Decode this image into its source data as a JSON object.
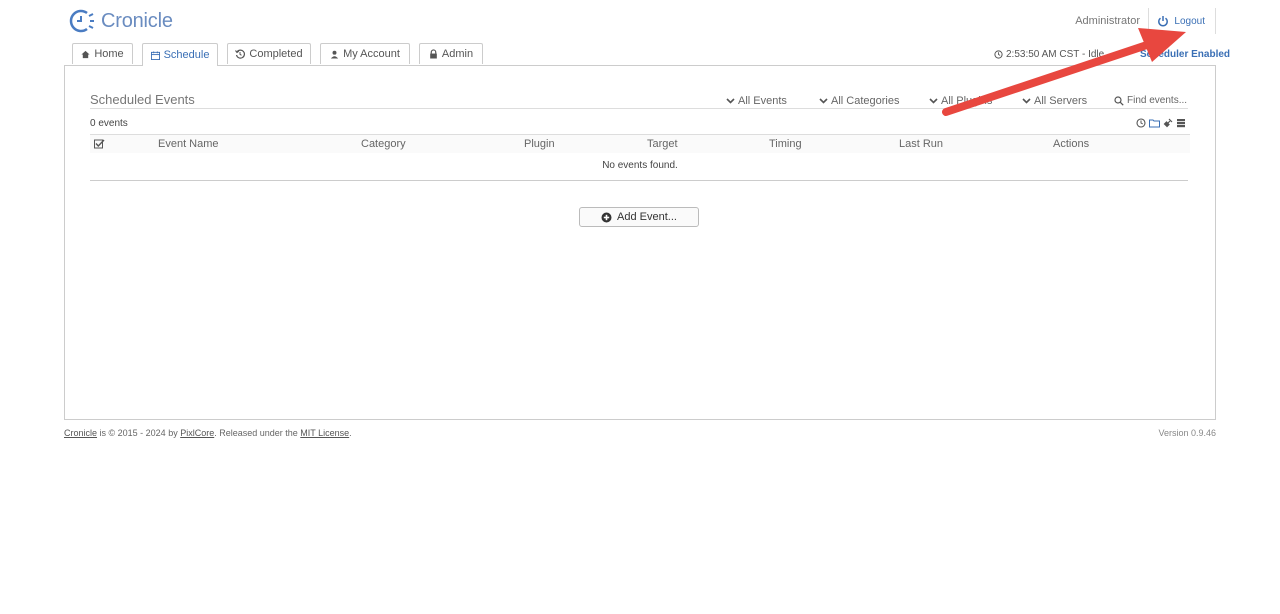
{
  "app": {
    "name": "Cronicle"
  },
  "header": {
    "user": "Administrator",
    "logout_label": "Logout"
  },
  "tabs": [
    {
      "label": "Home",
      "icon": "home-icon"
    },
    {
      "label": "Schedule",
      "icon": "calendar-icon",
      "active": true
    },
    {
      "label": "Completed",
      "icon": "history-icon"
    },
    {
      "label": "My Account",
      "icon": "user-icon"
    },
    {
      "label": "Admin",
      "icon": "lock-icon"
    }
  ],
  "status": {
    "time": "2:53:50 AM CST - Idle",
    "scheduler": "Scheduler Enabled"
  },
  "schedule": {
    "title": "Scheduled Events",
    "filters": [
      "All Events",
      "All Categories",
      "All Plugins",
      "All Servers"
    ],
    "search_placeholder": "Find events...",
    "count": "0 events",
    "columns": [
      "Event Name",
      "Category",
      "Plugin",
      "Target",
      "Timing",
      "Last Run",
      "Actions"
    ],
    "empty": "No events found.",
    "add_label": "Add Event..."
  },
  "footer": {
    "product": "Cronicle",
    "copyright_mid": " is © 2015 - 2024 by ",
    "company": "PixlCore",
    "released": ". Released under the ",
    "license": "MIT License",
    "period": ".",
    "version": "Version 0.9.46"
  },
  "colors": {
    "accent": "#3a6fb5",
    "logo": "#6a8cc0",
    "annotation": "#e8473f"
  }
}
